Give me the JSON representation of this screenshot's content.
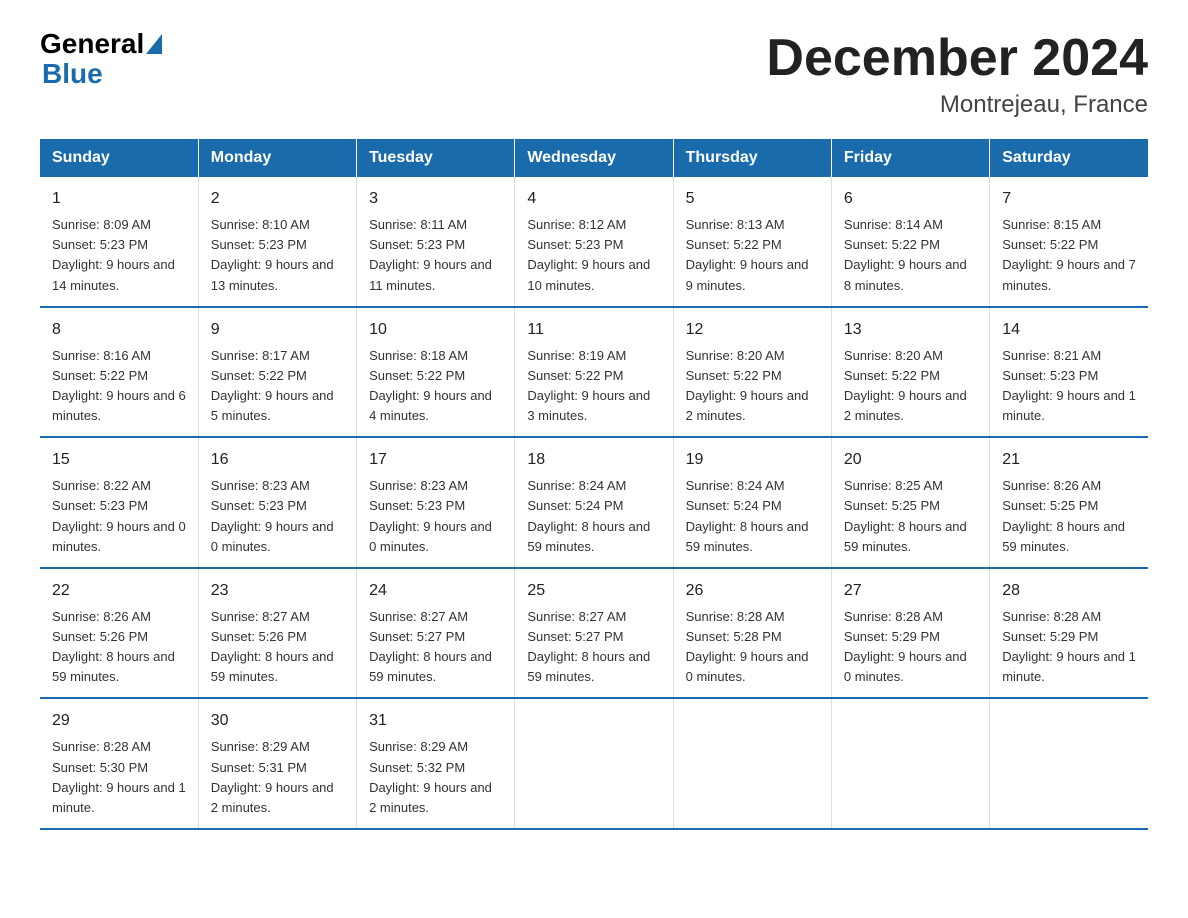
{
  "logo": {
    "general": "General",
    "blue": "Blue"
  },
  "title": "December 2024",
  "subtitle": "Montrejeau, France",
  "days_header": [
    "Sunday",
    "Monday",
    "Tuesday",
    "Wednesday",
    "Thursday",
    "Friday",
    "Saturday"
  ],
  "weeks": [
    [
      {
        "num": "1",
        "sunrise": "8:09 AM",
        "sunset": "5:23 PM",
        "daylight": "9 hours and 14 minutes."
      },
      {
        "num": "2",
        "sunrise": "8:10 AM",
        "sunset": "5:23 PM",
        "daylight": "9 hours and 13 minutes."
      },
      {
        "num": "3",
        "sunrise": "8:11 AM",
        "sunset": "5:23 PM",
        "daylight": "9 hours and 11 minutes."
      },
      {
        "num": "4",
        "sunrise": "8:12 AM",
        "sunset": "5:23 PM",
        "daylight": "9 hours and 10 minutes."
      },
      {
        "num": "5",
        "sunrise": "8:13 AM",
        "sunset": "5:22 PM",
        "daylight": "9 hours and 9 minutes."
      },
      {
        "num": "6",
        "sunrise": "8:14 AM",
        "sunset": "5:22 PM",
        "daylight": "9 hours and 8 minutes."
      },
      {
        "num": "7",
        "sunrise": "8:15 AM",
        "sunset": "5:22 PM",
        "daylight": "9 hours and 7 minutes."
      }
    ],
    [
      {
        "num": "8",
        "sunrise": "8:16 AM",
        "sunset": "5:22 PM",
        "daylight": "9 hours and 6 minutes."
      },
      {
        "num": "9",
        "sunrise": "8:17 AM",
        "sunset": "5:22 PM",
        "daylight": "9 hours and 5 minutes."
      },
      {
        "num": "10",
        "sunrise": "8:18 AM",
        "sunset": "5:22 PM",
        "daylight": "9 hours and 4 minutes."
      },
      {
        "num": "11",
        "sunrise": "8:19 AM",
        "sunset": "5:22 PM",
        "daylight": "9 hours and 3 minutes."
      },
      {
        "num": "12",
        "sunrise": "8:20 AM",
        "sunset": "5:22 PM",
        "daylight": "9 hours and 2 minutes."
      },
      {
        "num": "13",
        "sunrise": "8:20 AM",
        "sunset": "5:22 PM",
        "daylight": "9 hours and 2 minutes."
      },
      {
        "num": "14",
        "sunrise": "8:21 AM",
        "sunset": "5:23 PM",
        "daylight": "9 hours and 1 minute."
      }
    ],
    [
      {
        "num": "15",
        "sunrise": "8:22 AM",
        "sunset": "5:23 PM",
        "daylight": "9 hours and 0 minutes."
      },
      {
        "num": "16",
        "sunrise": "8:23 AM",
        "sunset": "5:23 PM",
        "daylight": "9 hours and 0 minutes."
      },
      {
        "num": "17",
        "sunrise": "8:23 AM",
        "sunset": "5:23 PM",
        "daylight": "9 hours and 0 minutes."
      },
      {
        "num": "18",
        "sunrise": "8:24 AM",
        "sunset": "5:24 PM",
        "daylight": "8 hours and 59 minutes."
      },
      {
        "num": "19",
        "sunrise": "8:24 AM",
        "sunset": "5:24 PM",
        "daylight": "8 hours and 59 minutes."
      },
      {
        "num": "20",
        "sunrise": "8:25 AM",
        "sunset": "5:25 PM",
        "daylight": "8 hours and 59 minutes."
      },
      {
        "num": "21",
        "sunrise": "8:26 AM",
        "sunset": "5:25 PM",
        "daylight": "8 hours and 59 minutes."
      }
    ],
    [
      {
        "num": "22",
        "sunrise": "8:26 AM",
        "sunset": "5:26 PM",
        "daylight": "8 hours and 59 minutes."
      },
      {
        "num": "23",
        "sunrise": "8:27 AM",
        "sunset": "5:26 PM",
        "daylight": "8 hours and 59 minutes."
      },
      {
        "num": "24",
        "sunrise": "8:27 AM",
        "sunset": "5:27 PM",
        "daylight": "8 hours and 59 minutes."
      },
      {
        "num": "25",
        "sunrise": "8:27 AM",
        "sunset": "5:27 PM",
        "daylight": "8 hours and 59 minutes."
      },
      {
        "num": "26",
        "sunrise": "8:28 AM",
        "sunset": "5:28 PM",
        "daylight": "9 hours and 0 minutes."
      },
      {
        "num": "27",
        "sunrise": "8:28 AM",
        "sunset": "5:29 PM",
        "daylight": "9 hours and 0 minutes."
      },
      {
        "num": "28",
        "sunrise": "8:28 AM",
        "sunset": "5:29 PM",
        "daylight": "9 hours and 1 minute."
      }
    ],
    [
      {
        "num": "29",
        "sunrise": "8:28 AM",
        "sunset": "5:30 PM",
        "daylight": "9 hours and 1 minute."
      },
      {
        "num": "30",
        "sunrise": "8:29 AM",
        "sunset": "5:31 PM",
        "daylight": "9 hours and 2 minutes."
      },
      {
        "num": "31",
        "sunrise": "8:29 AM",
        "sunset": "5:32 PM",
        "daylight": "9 hours and 2 minutes."
      },
      null,
      null,
      null,
      null
    ]
  ],
  "labels": {
    "sunrise_prefix": "Sunrise: ",
    "sunset_prefix": "Sunset: ",
    "daylight_prefix": "Daylight: "
  }
}
